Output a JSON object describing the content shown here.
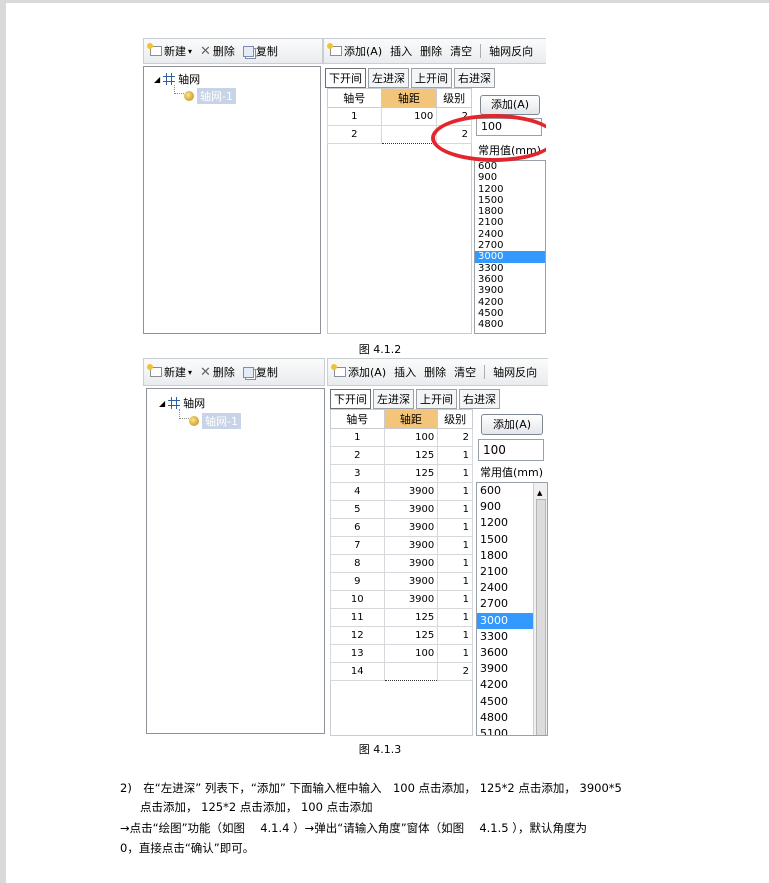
{
  "toolbar_left": {
    "new_label": "新建",
    "delete_label": "删除",
    "copy_label": "复制"
  },
  "toolbar_right": {
    "add_label": "添加(A)",
    "insert_label": "插入",
    "delete_label": "删除",
    "clear_label": "清空",
    "reverse_label": "轴网反向"
  },
  "tree": {
    "root_label": "轴网",
    "child_label": "轴网-1"
  },
  "tabs": [
    "下开间",
    "左进深",
    "上开间",
    "右进深"
  ],
  "table_headers": {
    "axis_no": "轴号",
    "spacing": "轴距",
    "level": "级别"
  },
  "add_button_label": "添加(A)",
  "input_value": "100",
  "common_values_label": "常用值(mm)",
  "common_values": [
    "600",
    "900",
    "1200",
    "1500",
    "1800",
    "2100",
    "2400",
    "2700",
    "3000",
    "3300",
    "3600",
    "3900",
    "4200",
    "4500",
    "4800",
    "5100"
  ],
  "common_values_selected": "3000",
  "figure1": {
    "caption": "图 4.1.2",
    "rows": [
      {
        "no": "1",
        "spacing": "100",
        "level": "2"
      },
      {
        "no": "2",
        "spacing": "",
        "level": "2"
      }
    ]
  },
  "figure2": {
    "caption": "图 4.1.3",
    "rows": [
      {
        "no": "1",
        "spacing": "100",
        "level": "2"
      },
      {
        "no": "2",
        "spacing": "125",
        "level": "1"
      },
      {
        "no": "3",
        "spacing": "125",
        "level": "1"
      },
      {
        "no": "4",
        "spacing": "3900",
        "level": "1"
      },
      {
        "no": "5",
        "spacing": "3900",
        "level": "1"
      },
      {
        "no": "6",
        "spacing": "3900",
        "level": "1"
      },
      {
        "no": "7",
        "spacing": "3900",
        "level": "1"
      },
      {
        "no": "8",
        "spacing": "3900",
        "level": "1"
      },
      {
        "no": "9",
        "spacing": "3900",
        "level": "1"
      },
      {
        "no": "10",
        "spacing": "3900",
        "level": "1"
      },
      {
        "no": "11",
        "spacing": "125",
        "level": "1"
      },
      {
        "no": "12",
        "spacing": "125",
        "level": "1"
      },
      {
        "no": "13",
        "spacing": "100",
        "level": "1"
      },
      {
        "no": "14",
        "spacing": "",
        "level": "2"
      }
    ]
  },
  "body_text": {
    "line1": "2)　在“左进深” 列表下，“添加” 下面输入框中输入　100 点击添加， 125*2 点击添加， 3900*5",
    "line2": "点击添加， 125*2 点击添加， 100 点击添加",
    "line3": "→点击“绘图”功能（如图　 4.1.4 ）→弹出“请输入角度”窗体（如图　 4.1.5 ），默认角度为",
    "line4": "0，直接点击“确认”即可。"
  }
}
